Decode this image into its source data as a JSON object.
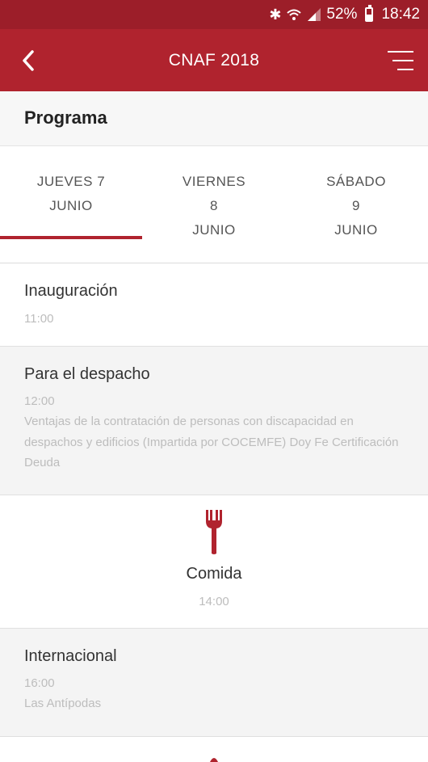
{
  "status_bar": {
    "battery": "52%",
    "battery_level": 0.52,
    "time": "18:42"
  },
  "app_bar": {
    "title": "CNAF 2018"
  },
  "section": {
    "title": "Programa"
  },
  "tabs": [
    {
      "line1": "JUEVES 7",
      "line2": "JUNIO",
      "line3": "",
      "selected": true
    },
    {
      "line1": "VIERNES",
      "line2": "8",
      "line3": "JUNIO",
      "selected": false
    },
    {
      "line1": "SÁBADO",
      "line2": "9",
      "line3": "JUNIO",
      "selected": false
    }
  ],
  "events": [
    {
      "name": "Inauguración",
      "time": "11:00",
      "description": ""
    },
    {
      "name": "Para el despacho",
      "time": "12:00",
      "description": "Ventajas de la contratación de personas con discapacidad en despachos y edificios (Impartida por COCEMFE) Doy Fe Certificación Deuda"
    },
    {
      "name": "Comida",
      "time": "14:00",
      "icon": "fork-icon"
    },
    {
      "name": "Internacional",
      "time": "16:00",
      "description": "Las Antípodas"
    }
  ],
  "colors": {
    "status_bar": "#9c1e29",
    "app_bar": "#b0232e",
    "accent": "#b0232e"
  }
}
